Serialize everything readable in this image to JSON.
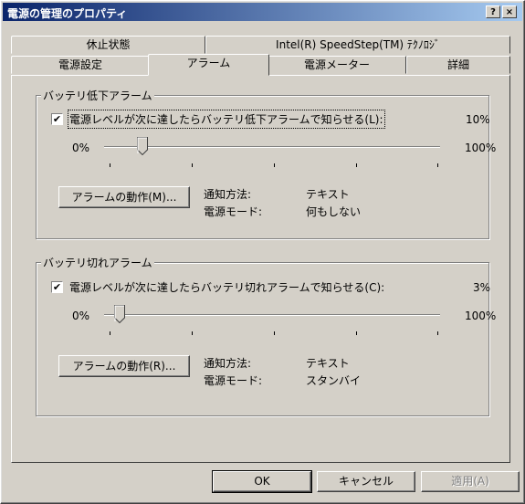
{
  "window": {
    "title": "電源の管理のプロパティ",
    "help_button": "?",
    "close_button": "×"
  },
  "tabs": {
    "row_back": [
      "休止状態",
      "Intel(R) SpeedStep(TM) ﾃｸﾉﾛｼﾞ"
    ],
    "row_front": [
      "電源設定",
      "アラーム",
      "電源メーター",
      "詳細"
    ],
    "active": "アラーム"
  },
  "low_battery": {
    "group_label": "バッテリ低下アラーム",
    "checkbox_label": "電源レベルが次に達したらバッテリ低下アラームで知らせる(L):",
    "checked": true,
    "level_value": "10%",
    "slider_min": "0%",
    "slider_max": "100%",
    "slider_level": 0.1,
    "action_button": "アラームの動作(M)...",
    "notify_label": "通知方法:",
    "notify_value": "テキスト",
    "mode_label": "電源モード:",
    "mode_value": "何もしない"
  },
  "critical_battery": {
    "group_label": "バッテリ切れアラーム",
    "checkbox_label": "電源レベルが次に達したらバッテリ切れアラームで知らせる(C):",
    "checked": true,
    "level_value": "3%",
    "slider_min": "0%",
    "slider_max": "100%",
    "slider_level": 0.03,
    "action_button": "アラームの動作(R)...",
    "notify_label": "通知方法:",
    "notify_value": "テキスト",
    "mode_label": "電源モード:",
    "mode_value": "スタンバイ"
  },
  "footer": {
    "ok": "OK",
    "cancel": "キャンセル",
    "apply": "適用(A)"
  },
  "colors": {
    "face": "#d4d0c8",
    "title_start": "#0a246a",
    "title_end": "#a6caf0"
  }
}
